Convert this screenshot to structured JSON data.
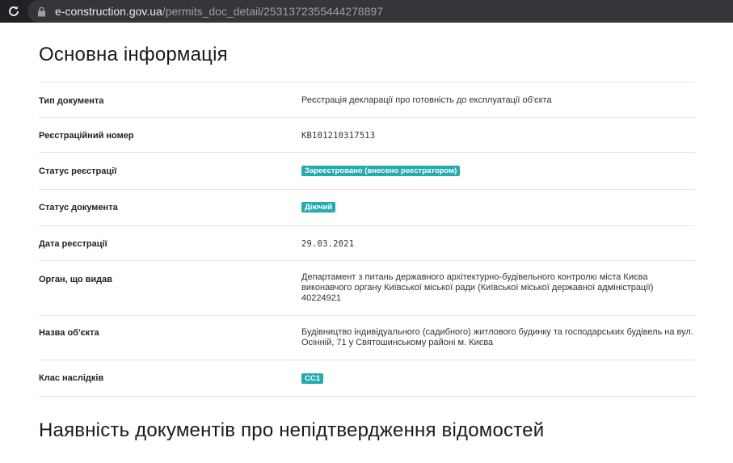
{
  "browser": {
    "url_host": "e-construction.gov.ua",
    "url_path": "/permits_doc_detail/2531372355444278897"
  },
  "main_section": {
    "title": "Основна інформація",
    "rows": [
      {
        "label": "Тип документа",
        "value": "Реєстрація декларації про готовність до експлуатації об'єкта"
      },
      {
        "label": "Реєстраційний номер",
        "value": "КВ101210317513"
      },
      {
        "label": "Статус реєстрації",
        "badge": "Зареєстровано (внесено реєстратором)"
      },
      {
        "label": "Статус документа",
        "badge": "Діючий"
      },
      {
        "label": "Дата реєстрації",
        "value": "29.03.2021"
      },
      {
        "label": "Орган, що видав",
        "value": "Департамент з питань державного архітектурно-будівельного контролю міста Києва виконавчого органу Київської міської ради (Київської міської державної адміністрації) 40224921"
      },
      {
        "label": "Назва об'єкта",
        "value": "Будівництво індивідуального (садибного) житлового будинку та господарських будівель на вул. Осінній, 71 у Святошинському районі м. Києва"
      },
      {
        "label": "Клас наслідків",
        "badge": "СС1"
      }
    ]
  },
  "second_section": {
    "title": "Наявність документів про непідтвердження відомостей"
  },
  "colors": {
    "badge": "#25aab0",
    "browser_bar": "#202124",
    "omnibox": "#35363a"
  }
}
